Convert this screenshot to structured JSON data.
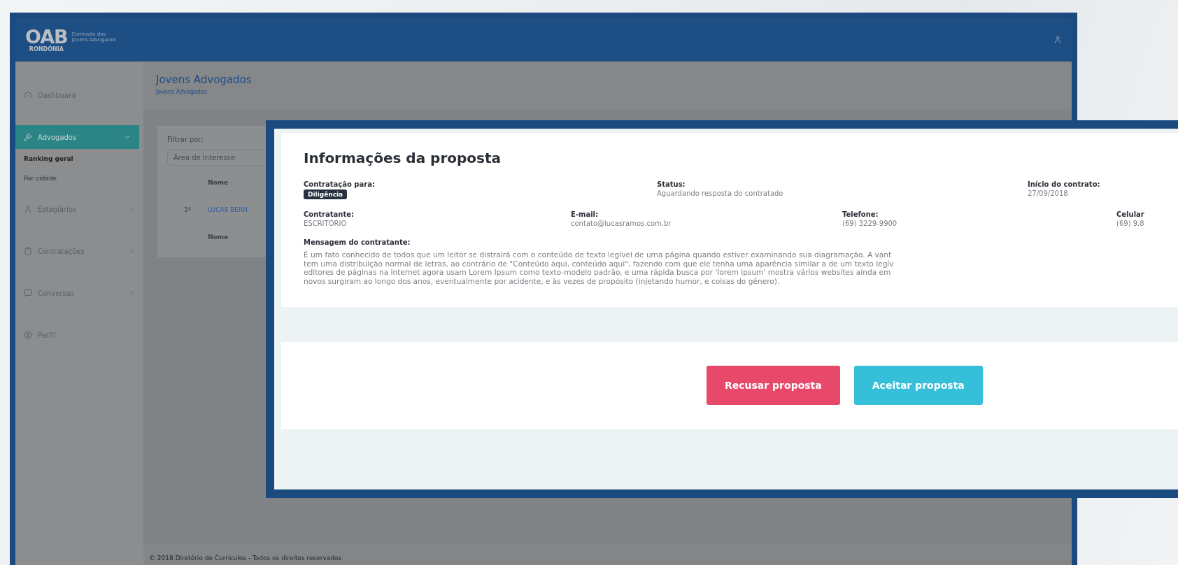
{
  "header": {
    "logo": {
      "mark": "OAB",
      "region": "RONDÔNIA",
      "caption": "Comissão dos Jovens Advogados"
    }
  },
  "sidebar": {
    "items": [
      {
        "label": "Dashboard",
        "selected": false
      },
      {
        "label": "Advogados",
        "selected": true,
        "expanded": true,
        "children": [
          {
            "label": "Ranking geral",
            "selected": true
          },
          {
            "label": "Por cidade",
            "selected": false
          }
        ]
      },
      {
        "label": "Estagiários",
        "selected": false,
        "expanded": false
      },
      {
        "label": "Contratações",
        "selected": false,
        "expanded": false
      },
      {
        "label": "Conversas",
        "selected": false,
        "expanded": false
      },
      {
        "label": "Perfil",
        "selected": false
      }
    ]
  },
  "page": {
    "title": "Jovens Advogados",
    "breadcrumb": "Jovens Advogados",
    "filter": {
      "label": "Filtrar por:",
      "value": "Área de Interesse"
    },
    "table": {
      "columns": [
        "Nome"
      ],
      "rows": [
        {
          "rank": "1º",
          "name": "LUCAS BERN"
        }
      ],
      "footer": [
        "Nome"
      ]
    }
  },
  "footer": {
    "text": "© 2018 Diretório de Currículos - Todos os direitos reservados"
  },
  "modal": {
    "title": "Informações da proposta",
    "rows": [
      [
        {
          "label": "Contratação para:",
          "badge": "Diligência"
        },
        {
          "label": "Status:",
          "value": "Aguardando resposta do contratado"
        },
        {
          "label": "Início do contrato:",
          "value": "27/09/2018"
        }
      ],
      [
        {
          "label": "Contratante:",
          "value": "ESCRITÓRIO"
        },
        {
          "label": "E-mail:",
          "value": "contato@lucasramos.com.br"
        },
        {
          "label": "Telefone:",
          "value": "(69) 3229-9900"
        },
        {
          "label": "Celular",
          "value": "(69) 9.8"
        }
      ]
    ],
    "message": {
      "label": "Mensagem do contratante:",
      "lines": [
        "É um fato conhecido de todos que um leitor se distrairá com o conteúdo de texto legível de uma página quando estiver examinando sua diagramação. A vant",
        "tem uma distribuição normal de letras, ao contrário de \"Conteúdo aqui, conteúdo aqui\", fazendo com que ele tenha uma aparência similar a de um texto legív",
        "editores de páginas na internet agora usam Lorem Ipsum como texto-modelo padrão, e uma rápida busca por 'lorem ipsum' mostra vários websites ainda em",
        "novos surgiram ao longo dos anos, eventualmente por acidente, e às vezes de propósito (injetando humor, e coisas do gênero)."
      ]
    },
    "buttons": [
      {
        "label": "Recusar proposta",
        "kind": "reject"
      },
      {
        "label": "Aceitar proposta",
        "kind": "accept"
      }
    ]
  }
}
